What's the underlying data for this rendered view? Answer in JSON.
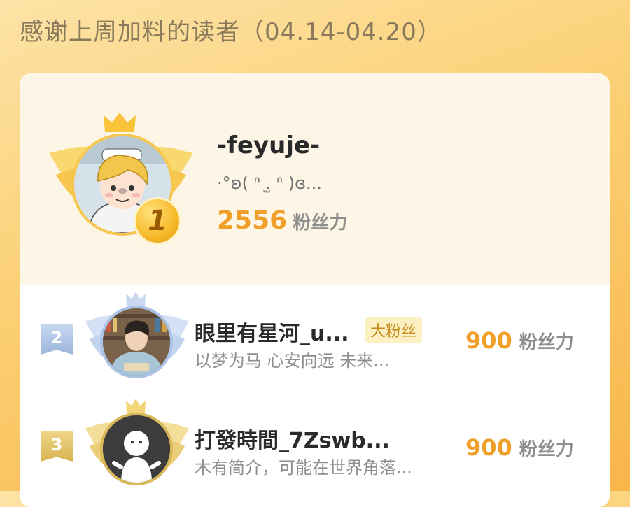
{
  "page": {
    "title": "感谢上周加料的读者（04.14-04.20）"
  },
  "top_fan": {
    "rank": "1",
    "name": "-feyuje-",
    "bio": "·°ʚ( ᐢ .̫ ᐢ )ɞ...",
    "score": "2556",
    "score_unit": "粉丝力",
    "avatar_icon": "anime-boy-avatar-icon"
  },
  "fans": [
    {
      "rank": "2",
      "name": "眼里有星河_u...",
      "badge": "大粉丝",
      "bio": "以梦为马 心安向远 未来...",
      "score": "900",
      "score_unit": "粉丝力",
      "avatar_icon": "reading-man-avatar-icon"
    },
    {
      "rank": "3",
      "name": "打發時間_7Zswb...",
      "bio": "木有简介，可能在世界角落...",
      "score": "900",
      "score_unit": "粉丝力",
      "avatar_icon": "default-ghost-avatar-icon"
    }
  ],
  "colors": {
    "background_gradient_start": "#fde3a7",
    "background_gradient_end": "#f8b54a",
    "score": "#f0a02a",
    "rank1_gold": "#f7b92a",
    "rank2_silver": "#a9c2e6",
    "rank3_bronze": "#e3c56a",
    "fan_badge_bg": "#fdf1c4",
    "fan_badge_text": "#c48b16"
  }
}
